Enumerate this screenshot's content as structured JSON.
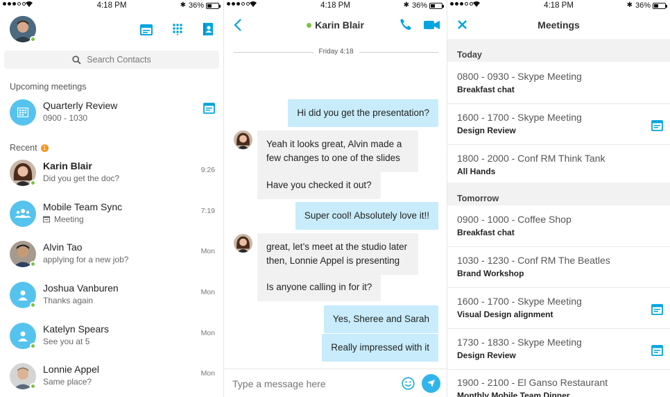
{
  "status": {
    "time": "4:18 PM",
    "battery": "36%"
  },
  "contacts_panel": {
    "search_placeholder": "Search Contacts",
    "upcoming_label": "Upcoming meetings",
    "upcoming": {
      "title": "Quarterly Review",
      "time": "0900 - 1030"
    },
    "recent_label": "Recent",
    "recent_badge": "1",
    "recent": [
      {
        "name": "Karin Blair",
        "preview": "Did you get the doc?",
        "time": "9:26",
        "bold": true
      },
      {
        "name": "Mobile Team Sync",
        "preview": "Meeting",
        "time": "7:19"
      },
      {
        "name": "Alvin Tao",
        "preview": "applying for a new job?",
        "time": "Mon"
      },
      {
        "name": "Joshua Vanburen",
        "preview": "Thanks again",
        "time": "Mon"
      },
      {
        "name": "Katelyn Spears",
        "preview": "See you at 5",
        "time": "Mon"
      },
      {
        "name": "Lonnie Appel",
        "preview": "Same place?",
        "time": "Mon"
      }
    ]
  },
  "chat_panel": {
    "contact_name": "Karin Blair",
    "date_divider": "Friday 4:18",
    "messages": [
      {
        "from": "me",
        "text": "Hi did you get the presentation?"
      },
      {
        "from": "them",
        "text": "Yeah it looks great, Alvin made a few changes to one of the slides"
      },
      {
        "from": "them",
        "text": "Have you checked it out?"
      },
      {
        "from": "me",
        "text": "Super cool! Absolutely love it!!"
      },
      {
        "from": "them",
        "text": "great, let’s meet at the studio later then, Lonnie Appel is presenting"
      },
      {
        "from": "them",
        "text": "Is anyone calling in for it?"
      },
      {
        "from": "me",
        "text": "Yes, Sheree and Sarah"
      },
      {
        "from": "me",
        "text": "Really impressed with it"
      }
    ],
    "input_placeholder": "Type a message here"
  },
  "meetings_panel": {
    "title": "Meetings",
    "today_label": "Today",
    "today": [
      {
        "time_place": "0800 - 0930 - Skype Meeting",
        "title": "Breakfast chat",
        "calendar_icon": false
      },
      {
        "time_place": "1600 - 1700 - Skype Meeting",
        "title": "Design Review",
        "calendar_icon": true
      },
      {
        "time_place": "1800 - 2000 - Conf RM Think Tank",
        "title": "All Hands",
        "calendar_icon": false
      }
    ],
    "tomorrow_label": "Tomorrow",
    "tomorrow": [
      {
        "time_place": "0900 - 1000 - Coffee Shop",
        "title": "Breakfast chat",
        "calendar_icon": false
      },
      {
        "time_place": "1030 - 1230 - Conf RM The Beatles",
        "title": "Brand Workshop",
        "calendar_icon": false
      },
      {
        "time_place": "1600 - 1700 - Skype Meeting",
        "title": "Visual Design alignment",
        "calendar_icon": true
      },
      {
        "time_place": "1730 - 1830 - Skype Meeting",
        "title": "Design Review",
        "calendar_icon": true
      },
      {
        "time_place": "1900 - 2100 - El Ganso Restaurant",
        "title": "Monthly Mobile Team Dinner",
        "calendar_icon": false
      }
    ]
  },
  "colors": {
    "accent": "#00a4e0",
    "presence": "#7cc242",
    "my_bubble": "#c8ecfb",
    "their_bubble": "#f1f1f1",
    "badge": "#f7941d"
  }
}
